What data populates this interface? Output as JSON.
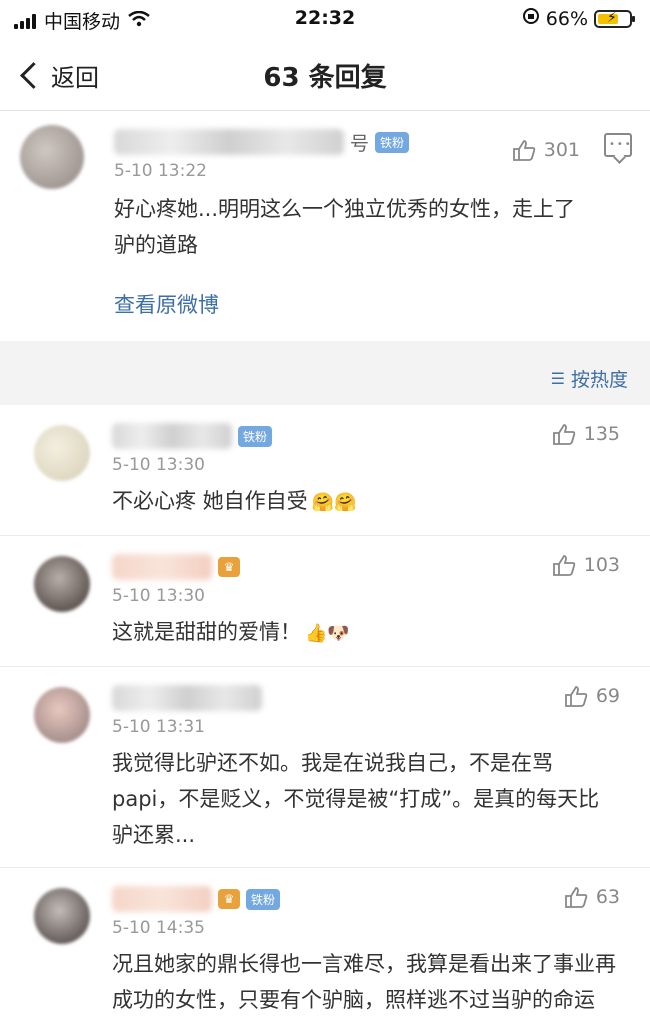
{
  "status_bar": {
    "carrier": "中国移动",
    "time": "22:32",
    "battery_pct": "66%",
    "battery_level": 0.66
  },
  "nav": {
    "back_label": "返回",
    "title": "63 条回复"
  },
  "main_post": {
    "name_tail": "号",
    "badge": "铁粉",
    "likes": "301",
    "time": "5-10 13:22",
    "text": "好心疼她...明明这么一个独立优秀的女性，走上了驴的道路",
    "link": "查看原微博"
  },
  "sort": {
    "label": "按热度",
    "icon": "sort-icon"
  },
  "replies": [
    {
      "name_tail": "",
      "badge": "铁粉",
      "likes": "135",
      "time": "5-10 13:30",
      "text": "不必心疼 她自作自受",
      "emoji": "🤗🤗"
    },
    {
      "name_tail": "",
      "badge": "",
      "likes": "103",
      "time": "5-10 13:30",
      "text": "这就是甜甜的爱情！",
      "emoji": "👍🐶"
    },
    {
      "name_tail": "",
      "badge": "",
      "likes": "69",
      "time": "5-10 13:31",
      "text": "我觉得比驴还不如。我是在说我自己，不是在骂papi，不是贬义，不觉得是被“打成”。是真的每天比驴还累...",
      "emoji": ""
    },
    {
      "name_tail": "",
      "badge": "铁粉",
      "likes": "63",
      "time": "5-10 14:35",
      "text": "况且她家的鼎长得也一言难尽，我算是看出来了事业再成功的女性，只要有个驴脑，照样逃不过当驴的命运",
      "emoji": ""
    }
  ]
}
